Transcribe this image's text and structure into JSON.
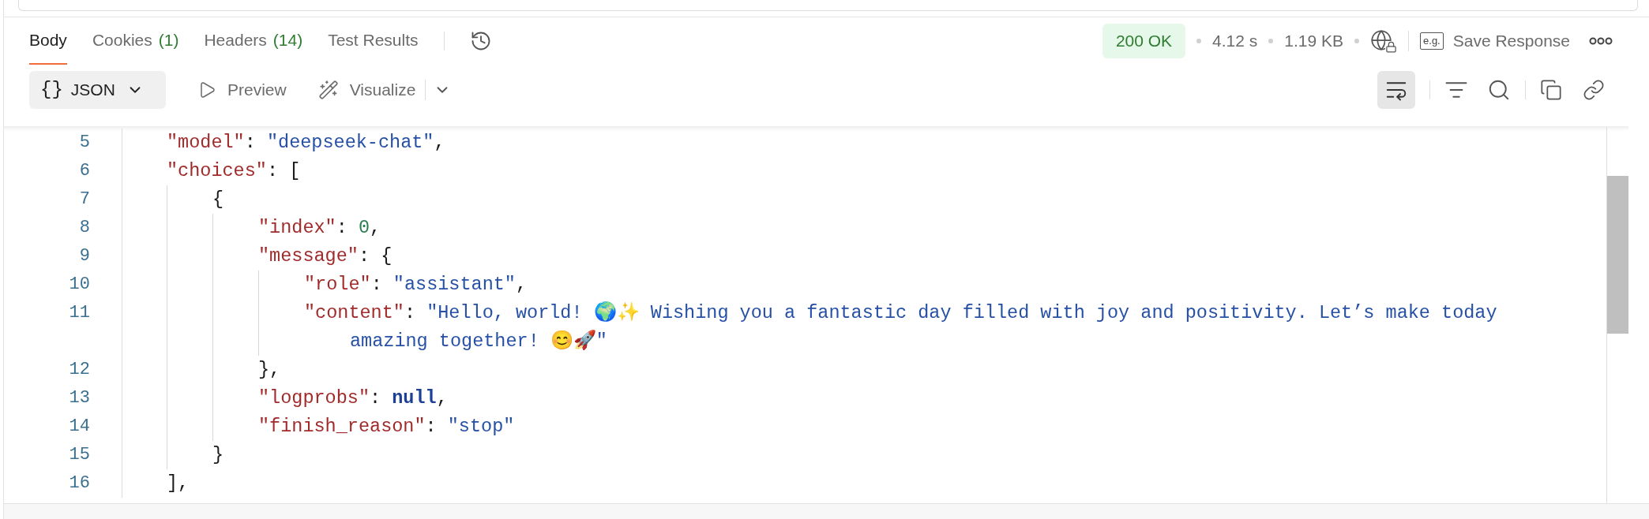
{
  "tabs": [
    {
      "label": "Body",
      "selected": true
    },
    {
      "label": "Cookies",
      "count": "(1)",
      "selected": false
    },
    {
      "label": "Headers",
      "count": "(14)",
      "selected": false
    },
    {
      "label": "Test Results",
      "selected": false
    }
  ],
  "response_meta": {
    "status": "200 OK",
    "time": "4.12 s",
    "size": "1.19 KB",
    "save_icon_text": "e.g.",
    "save_label": "Save Response"
  },
  "view_toolbar": {
    "format": "JSON",
    "format_icon": "{}",
    "modes": [
      "Preview",
      "Visualize"
    ],
    "wrap_on": true
  },
  "code_lines": [
    {
      "number": "5",
      "tokens": [
        {
          "kind": "key",
          "text": "\"model\""
        },
        {
          "kind": "punct",
          "text": ": "
        },
        {
          "kind": "string",
          "text": "\"deepseek-chat\""
        },
        {
          "kind": "punct",
          "text": ","
        }
      ]
    },
    {
      "number": "6",
      "tokens": [
        {
          "kind": "key",
          "text": "\"choices\""
        },
        {
          "kind": "punct",
          "text": ": ["
        }
      ],
      "children": [
        {
          "number": "7",
          "tokens": [
            {
              "kind": "punct",
              "text": "{"
            }
          ],
          "children": [
            {
              "number": "8",
              "tokens": [
                {
                  "kind": "key",
                  "text": "\"index\""
                },
                {
                  "kind": "punct",
                  "text": ": "
                },
                {
                  "kind": "number",
                  "text": "0"
                },
                {
                  "kind": "punct",
                  "text": ","
                }
              ]
            },
            {
              "number": "9",
              "tokens": [
                {
                  "kind": "key",
                  "text": "\"message\""
                },
                {
                  "kind": "punct",
                  "text": ": {"
                }
              ],
              "children": [
                {
                  "number": "10",
                  "tokens": [
                    {
                      "kind": "key",
                      "text": "\"role\""
                    },
                    {
                      "kind": "punct",
                      "text": ": "
                    },
                    {
                      "kind": "string",
                      "text": "\"assistant\""
                    },
                    {
                      "kind": "punct",
                      "text": ","
                    }
                  ]
                },
                {
                  "number": "11",
                  "tokens": [
                    {
                      "kind": "key",
                      "text": "\"content\""
                    },
                    {
                      "kind": "punct",
                      "text": ": "
                    },
                    {
                      "kind": "string",
                      "text": "\"Hello, world! 🌍✨ Wishing you a fantastic day filled with joy and positivity. Let’s make today amazing together! 😊🚀\""
                    }
                  ]
                }
              ]
            },
            {
              "number": "12",
              "tokens": [
                {
                  "kind": "punct",
                  "text": "},"
                }
              ]
            },
            {
              "number": "13",
              "tokens": [
                {
                  "kind": "key",
                  "text": "\"logprobs\""
                },
                {
                  "kind": "punct",
                  "text": ": "
                },
                {
                  "kind": "null",
                  "text": "null"
                },
                {
                  "kind": "punct",
                  "text": ","
                }
              ]
            },
            {
              "number": "14",
              "tokens": [
                {
                  "kind": "key",
                  "text": "\"finish_reason\""
                },
                {
                  "kind": "punct",
                  "text": ": "
                },
                {
                  "kind": "string",
                  "text": "\"stop\""
                }
              ]
            }
          ]
        },
        {
          "number": "15",
          "tokens": [
            {
              "kind": "punct",
              "text": "}"
            }
          ]
        }
      ]
    },
    {
      "number": "16",
      "tokens": [
        {
          "kind": "punct",
          "text": "],"
        }
      ]
    }
  ]
}
